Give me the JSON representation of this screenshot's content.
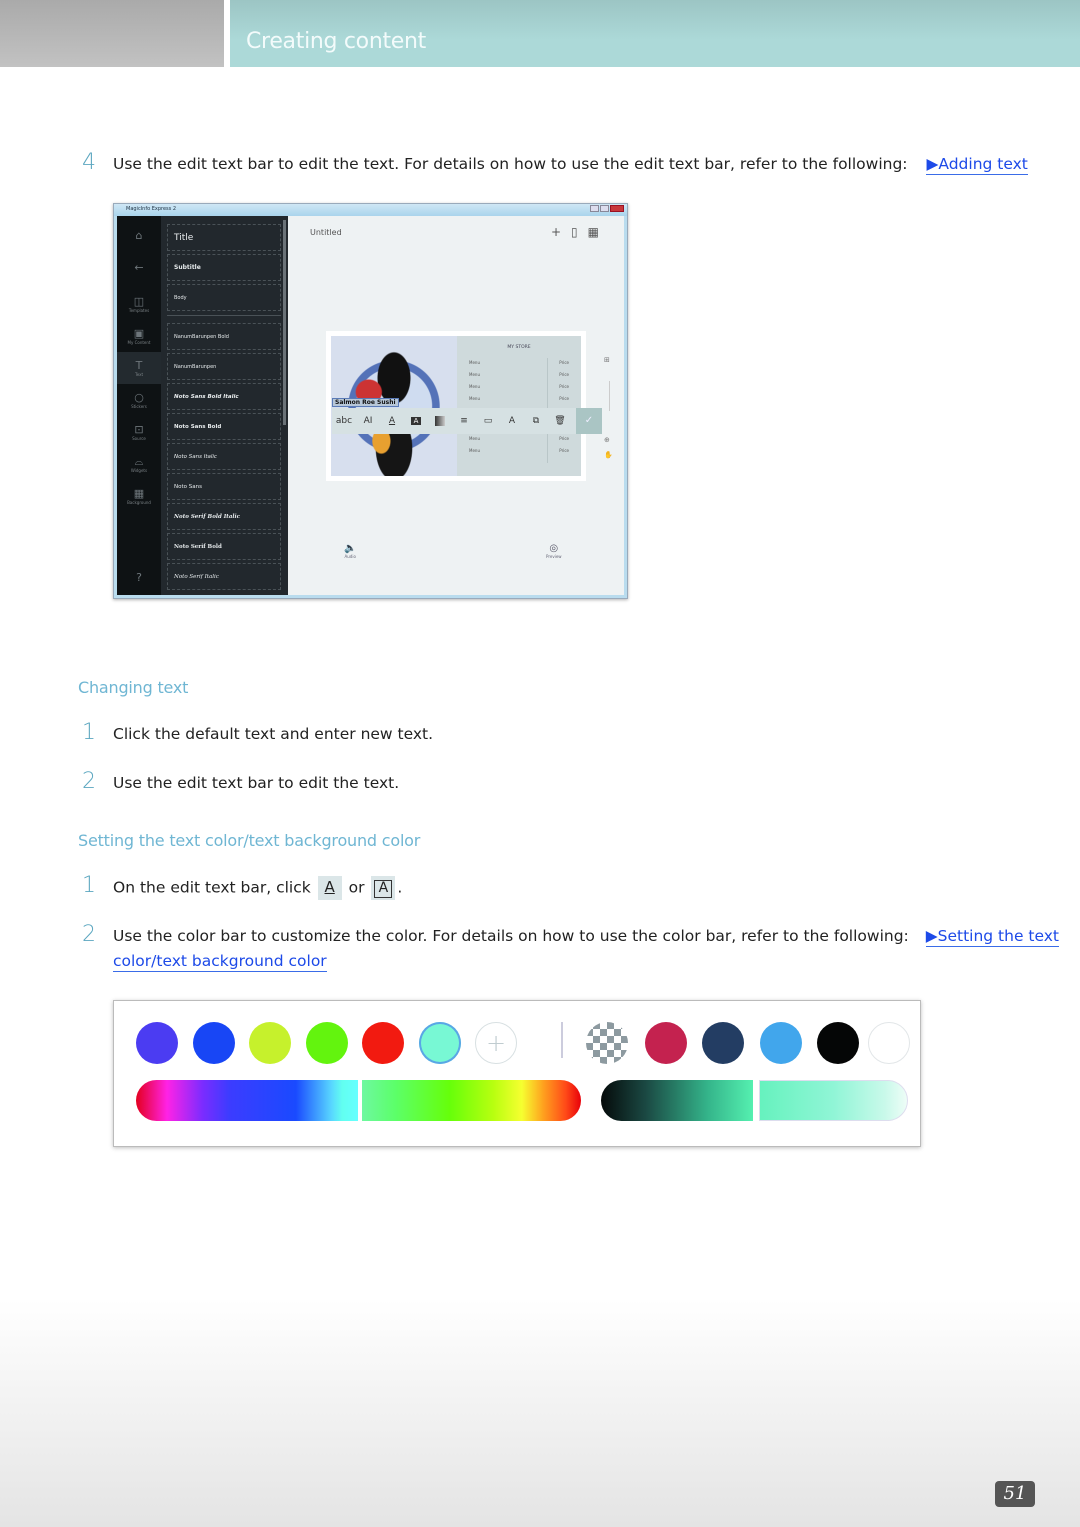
{
  "header": {
    "title": "Creating content"
  },
  "step4": {
    "number": "4",
    "text": "Use the edit text bar to edit the text. For details on how to use the edit text bar, refer to the following:",
    "link_arrow": "▶",
    "link_label": "Adding text"
  },
  "app": {
    "window_title": "MagicInfo Express 2",
    "rail": [
      {
        "icon": "home-icon",
        "glyph": "⌂",
        "label": ""
      },
      {
        "icon": "back-arrow-icon",
        "glyph": "←",
        "label": ""
      },
      {
        "icon": "templates-icon",
        "glyph": "◫",
        "label": "Templates"
      },
      {
        "icon": "my-content-icon",
        "glyph": "▣",
        "label": "My Content"
      },
      {
        "icon": "text-icon",
        "glyph": "T",
        "label": "Text"
      },
      {
        "icon": "stickers-icon",
        "glyph": "○",
        "label": "Stickers"
      },
      {
        "icon": "source-icon",
        "glyph": "⊡",
        "label": "Source"
      },
      {
        "icon": "widgets-icon",
        "glyph": "⌓",
        "label": "Widgets"
      },
      {
        "icon": "background-icon",
        "glyph": "▦",
        "label": "Background"
      },
      {
        "icon": "help-icon",
        "glyph": "?",
        "label": ""
      }
    ],
    "fonts": [
      "Title",
      "Subtitle",
      "Body",
      "NanumBarunpen Bold",
      "NanumBarunpen",
      "Noto Sans Bold Italic",
      "Noto Sans Bold",
      "Noto Sans Italic",
      "Noto Sans",
      "Noto Serif Bold Italic",
      "Noto Serif Bold",
      "Noto Serif Italic"
    ],
    "canvas_title": "Untitled",
    "toolbar": [
      "add-icon",
      "save-icon",
      "schedule-icon"
    ],
    "photo_label": "Salmon Roe Sushi",
    "menu_title": "MY STORE",
    "menu_rows": [
      {
        "item": "Menu",
        "price": "Price"
      },
      {
        "item": "Menu",
        "price": "Price"
      },
      {
        "item": "Menu",
        "price": "Price"
      },
      {
        "item": "Menu",
        "price": "Price"
      },
      {
        "item": "Menu",
        "price": "Price"
      },
      {
        "item": "Menu",
        "price": "Price"
      },
      {
        "item": "Menu",
        "price": "Price"
      },
      {
        "item": "Menu",
        "price": "Price"
      }
    ],
    "edit_bar": [
      {
        "name": "font-style-tool",
        "glyph": "abc"
      },
      {
        "name": "font-size-tool",
        "glyph": "AI"
      },
      {
        "name": "text-color-tool",
        "glyph": "A"
      },
      {
        "name": "text-background-tool",
        "glyph": "A"
      },
      {
        "name": "gradient-tool",
        "glyph": "▌"
      },
      {
        "name": "align-tool",
        "glyph": "≡"
      },
      {
        "name": "text-box-tool",
        "glyph": "▭"
      },
      {
        "name": "text-effect-tool",
        "glyph": "A"
      },
      {
        "name": "arrange-tool",
        "glyph": "⧉"
      },
      {
        "name": "delete-tool",
        "glyph": "🗑"
      }
    ],
    "confirm_glyph": "✓",
    "audio_label": "Audio",
    "preview_label": "Preview"
  },
  "changing_text": {
    "heading": "Changing text",
    "steps": [
      {
        "number": "1",
        "text": "Click the default text and enter new text."
      },
      {
        "number": "2",
        "text": "Use the edit text bar to edit the text."
      }
    ]
  },
  "color_section": {
    "heading": "Setting the text color/text background color",
    "step1": {
      "number": "1",
      "text_before": "On the edit text bar, click",
      "or": "or",
      "end": "."
    },
    "step2": {
      "number": "2",
      "text": "Use the color bar to customize the color. For details on how to use the color bar, refer to the following:",
      "link_arrow": "▶",
      "link_label_1": "Setting the text",
      "link_label_2": "color/text background color"
    }
  },
  "palette": {
    "swatches": [
      {
        "name": "swatch-violet",
        "color": "#4b3cf2"
      },
      {
        "name": "swatch-blue",
        "color": "#1846f5"
      },
      {
        "name": "swatch-lime",
        "color": "#c6f12c"
      },
      {
        "name": "swatch-green",
        "color": "#63f40e"
      },
      {
        "name": "swatch-red",
        "color": "#f21a10"
      },
      {
        "name": "swatch-mint",
        "color": "#78f8d4",
        "selected": true
      },
      {
        "name": "swatch-add",
        "plus": true
      }
    ],
    "swatches_right": [
      {
        "name": "swatch-transparent",
        "transparent": true
      },
      {
        "name": "swatch-crimson",
        "color": "#c4224f"
      },
      {
        "name": "swatch-navy",
        "color": "#233d63"
      },
      {
        "name": "swatch-sky",
        "color": "#41a6ec"
      },
      {
        "name": "swatch-black",
        "color": "#050606"
      },
      {
        "name": "swatch-white",
        "color": "#ffffff"
      }
    ],
    "add_glyph": "+"
  },
  "page_number": "51"
}
